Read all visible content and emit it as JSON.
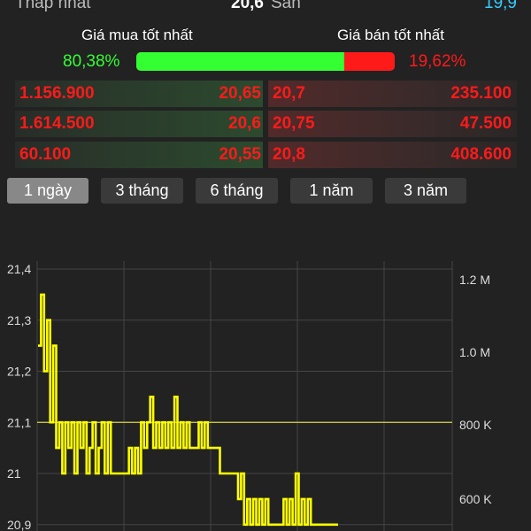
{
  "summary": {
    "low_label": "Thấp nhất",
    "low_value": "20,6",
    "floor_label": "Sàn",
    "floor_value": "19,9"
  },
  "best": {
    "buy_label": "Giá mua tốt nhất",
    "sell_label": "Giá bán tốt nhất",
    "buy_pct": "80,38%",
    "sell_pct": "19,62%",
    "buy_fraction": 0.8038
  },
  "orderbook": [
    {
      "bid_volume": "1.156.900",
      "bid_price": "20,65",
      "ask_price": "20,7",
      "ask_volume": "235.100"
    },
    {
      "bid_volume": "1.614.500",
      "bid_price": "20,6",
      "ask_price": "20,75",
      "ask_volume": "47.500"
    },
    {
      "bid_volume": "60.100",
      "bid_price": "20,55",
      "ask_price": "20,8",
      "ask_volume": "408.600"
    }
  ],
  "tabs": [
    "1 ngày",
    "3 tháng",
    "6 tháng",
    "1 năm",
    "3 năm"
  ],
  "active_tab": 0,
  "colors": {
    "background": "#222222",
    "up": "#33ff33",
    "down": "#ff1a1a",
    "floor": "#33ccff",
    "price_line": "#ffff00",
    "reference_line": "#d6d640",
    "grid": "#444444"
  },
  "chart_data": {
    "type": "line",
    "title": "",
    "xlabel": "",
    "ylabel": "",
    "y_left_ticks": [
      "21,4",
      "21,3",
      "21,2",
      "21,1",
      "21",
      "20,9"
    ],
    "y_left_values": [
      21.4,
      21.3,
      21.2,
      21.1,
      21.0,
      20.9
    ],
    "y_right_ticks": [
      "1.2 M",
      "1.0 M",
      "800 K",
      "600 K"
    ],
    "reference_price": 21.1,
    "grid": true,
    "series": [
      {
        "values": [
          21.25,
          21.35,
          21.2,
          21.3,
          21.1,
          21.25,
          21.05,
          21.1,
          21.0,
          21.1,
          21.05,
          21.1,
          21.0,
          21.1,
          21.05,
          21.1,
          21.0,
          21.05,
          21.1,
          21.0,
          21.05,
          21.1,
          21.0,
          21.1,
          21.0,
          21.0,
          21.0,
          21.0,
          21.0,
          21.0,
          21.05,
          21.0,
          21.05,
          21.0,
          21.1,
          21.05,
          21.1,
          21.15,
          21.05,
          21.1,
          21.05,
          21.1,
          21.05,
          21.1,
          21.05,
          21.15,
          21.05,
          21.1,
          21.05,
          21.1,
          21.05,
          21.05,
          21.05,
          21.1,
          21.05,
          21.1,
          21.05,
          21.05,
          21.05,
          21.05,
          21.0,
          21.0,
          21.0,
          21.0,
          21.0,
          21.0,
          20.95,
          21.0,
          20.9,
          20.95,
          20.9,
          20.95,
          20.9,
          20.95,
          20.9,
          20.95,
          20.9,
          20.9,
          20.9,
          20.9,
          20.9,
          20.95,
          20.9,
          20.95,
          20.9,
          21.0,
          20.9,
          20.95,
          20.9,
          20.95,
          20.9,
          20.9,
          20.9,
          20.9,
          20.9,
          20.9,
          20.9,
          20.9,
          20.9,
          20.9
        ]
      }
    ]
  }
}
